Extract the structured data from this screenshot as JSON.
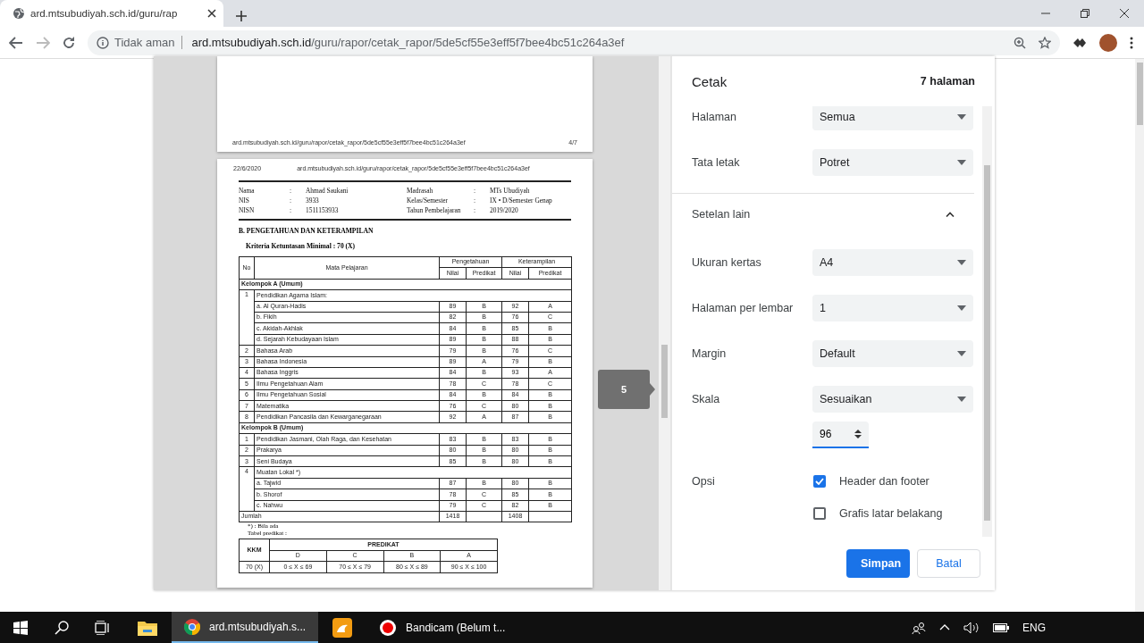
{
  "browser": {
    "tab": {
      "title": "ard.mtsubudiyah.sch.id/guru/rap"
    },
    "address": {
      "security": "Tidak aman",
      "host": "ard.mtsubudiyah.sch.id",
      "path": "/guru/rapor/cetak_rapor/5de5cf55e3eff5f7bee4bc51c264a3ef"
    }
  },
  "preview": {
    "previous_page": {
      "footer_url": "ard.mtsubudiyah.sch.id/guru/rapor/cetak_rapor/5de5cf55e3eff5f7bee4bc51c264a3ef",
      "page_number": "4/7"
    },
    "page": {
      "date": "22/6/2020",
      "header_url": "ard.mtsubudiyah.sch.id/guru/rapor/cetak_rapor/5de5cf55e3eff5f7bee4bc51c264a3ef",
      "identity_left": [
        {
          "label": "Nama",
          "separator": ":",
          "value": "Ahmad Saukani"
        },
        {
          "label": "NIS",
          "separator": ":",
          "value": "3933"
        },
        {
          "label": "NISN",
          "separator": ":",
          "value": "1511153933"
        }
      ],
      "identity_right": [
        {
          "label": "Madrasah",
          "separator": ":",
          "value": "MTs Ubudiyah"
        },
        {
          "label": "Kelas/Semester",
          "separator": ":",
          "value": "IX • D/Semester Genap"
        },
        {
          "label": "Tahun Pembelajaran",
          "separator": ":",
          "value": "2019/2020"
        }
      ],
      "section_title": "B. PENGETAHUAN DAN KETERAMPILAN",
      "kkm": "Kriteria Ketuntasan Minimal : 70 (X)",
      "table": {
        "columns": {
          "no": "No",
          "subject": "Mata Pelajaran",
          "knowledge": "Pengetahuan",
          "skill": "Keterampilan",
          "sub": [
            "Nilai",
            "Predikat",
            "Nilai",
            "Predikat"
          ]
        },
        "rows": [
          {
            "kind": "group",
            "label": "Kelompok A (Umum)"
          },
          {
            "kind": "parent",
            "no": "1",
            "label": "Pendidikan Agama Islam:",
            "children": [
              {
                "label": "a. Al Quran-Hadis",
                "cells": [
                  "89",
                  "B",
                  "92",
                  "A"
                ]
              },
              {
                "label": "b. Fikih",
                "cells": [
                  "82",
                  "B",
                  "76",
                  "C"
                ]
              },
              {
                "label": "c. Akidah-Akhlak",
                "cells": [
                  "84",
                  "B",
                  "85",
                  "B"
                ]
              },
              {
                "label": "d. Sejarah Kebudayaan Islam",
                "cells": [
                  "89",
                  "B",
                  "88",
                  "B"
                ]
              }
            ]
          },
          {
            "kind": "subject",
            "no": "2",
            "label": "Bahasa Arab",
            "cells": [
              "79",
              "B",
              "76",
              "C"
            ]
          },
          {
            "kind": "subject",
            "no": "3",
            "label": "Bahasa Indonesia",
            "cells": [
              "89",
              "A",
              "79",
              "B"
            ]
          },
          {
            "kind": "subject",
            "no": "4",
            "label": "Bahasa Inggris",
            "cells": [
              "84",
              "B",
              "93",
              "A"
            ]
          },
          {
            "kind": "subject",
            "no": "5",
            "label": "Ilmu Pengetahuan Alam",
            "cells": [
              "78",
              "C",
              "78",
              "C"
            ]
          },
          {
            "kind": "subject",
            "no": "6",
            "label": "Ilmu Pengetahuan Sosial",
            "cells": [
              "84",
              "B",
              "84",
              "B"
            ]
          },
          {
            "kind": "subject",
            "no": "7",
            "label": "Matematika",
            "cells": [
              "76",
              "C",
              "80",
              "B"
            ]
          },
          {
            "kind": "subject",
            "no": "8",
            "label": "Pendidikan Pancasila dan Kewarganegaraan",
            "cells": [
              "92",
              "A",
              "87",
              "B"
            ]
          },
          {
            "kind": "group",
            "label": "Kelompok B (Umum)"
          },
          {
            "kind": "subject",
            "no": "1",
            "label": "Pendidikan Jasmani, Olah Raga, dan Kesehatan",
            "cells": [
              "83",
              "B",
              "83",
              "B"
            ]
          },
          {
            "kind": "subject",
            "no": "2",
            "label": "Prakarya",
            "cells": [
              "80",
              "B",
              "80",
              "B"
            ]
          },
          {
            "kind": "subject",
            "no": "3",
            "label": "Seni Budaya",
            "cells": [
              "85",
              "B",
              "80",
              "B"
            ]
          },
          {
            "kind": "parent",
            "no": "4",
            "label": "Muatan Lokal *)",
            "children": [
              {
                "label": "a. Tajwid",
                "cells": [
                  "87",
                  "B",
                  "80",
                  "B"
                ]
              },
              {
                "label": "b. Shorof",
                "cells": [
                  "78",
                  "C",
                  "85",
                  "B"
                ]
              },
              {
                "label": "c. Nahwu",
                "cells": [
                  "79",
                  "C",
                  "82",
                  "B"
                ]
              }
            ]
          },
          {
            "kind": "total",
            "label": "Jumlah",
            "knowledge_total": "1418",
            "skill_total": "1408"
          }
        ]
      },
      "footnote": "*) : Bila ada",
      "predikat_caption": "Tabel predikat :",
      "predikat_table": {
        "kkm_header": "KKM",
        "predikat_header": "PREDIKAT",
        "grades": [
          "D",
          "C",
          "B",
          "A"
        ],
        "kkm": "70 (X)",
        "ranges": [
          "0 ≤ X ≤ 69",
          "70 ≤ X ≤ 79",
          "80 ≤ X ≤ 89",
          "90 ≤ X ≤ 100"
        ]
      }
    },
    "page_badge": "5"
  },
  "print_panel": {
    "title": "Cetak",
    "page_count": "7 halaman",
    "settings": [
      {
        "kind": "select",
        "label": "Halaman",
        "value": "Semua"
      },
      {
        "kind": "select",
        "label": "Tata letak",
        "value": "Potret"
      },
      {
        "kind": "section",
        "label": "Setelan lain",
        "expanded": true
      },
      {
        "kind": "select",
        "label": "Ukuran kertas",
        "value": "A4"
      },
      {
        "kind": "select",
        "label": "Halaman per lembar",
        "value": "1"
      },
      {
        "kind": "select",
        "label": "Margin",
        "value": "Default"
      },
      {
        "kind": "select",
        "label": "Skala",
        "value": "Sesuaikan"
      },
      {
        "kind": "number",
        "value": "96"
      },
      {
        "kind": "checkbox",
        "label": "Opsi",
        "text": "Header dan footer",
        "checked": true
      },
      {
        "kind": "checkbox",
        "text": "Grafis latar belakang",
        "checked": false
      }
    ],
    "buttons": [
      {
        "kind": "primary",
        "label": "Simpan"
      },
      {
        "kind": "secondary",
        "label": "Batal"
      }
    ]
  },
  "taskbar": {
    "apps": [
      {
        "kind": "explorer",
        "active": false
      },
      {
        "kind": "chrome",
        "label": "ard.mtsubudiyah.s...",
        "active": true
      },
      {
        "kind": "uc",
        "active": false
      },
      {
        "kind": "bandicam",
        "label": "Bandicam (Belum t...",
        "active": false
      }
    ],
    "tray": {
      "language": "ENG"
    }
  }
}
